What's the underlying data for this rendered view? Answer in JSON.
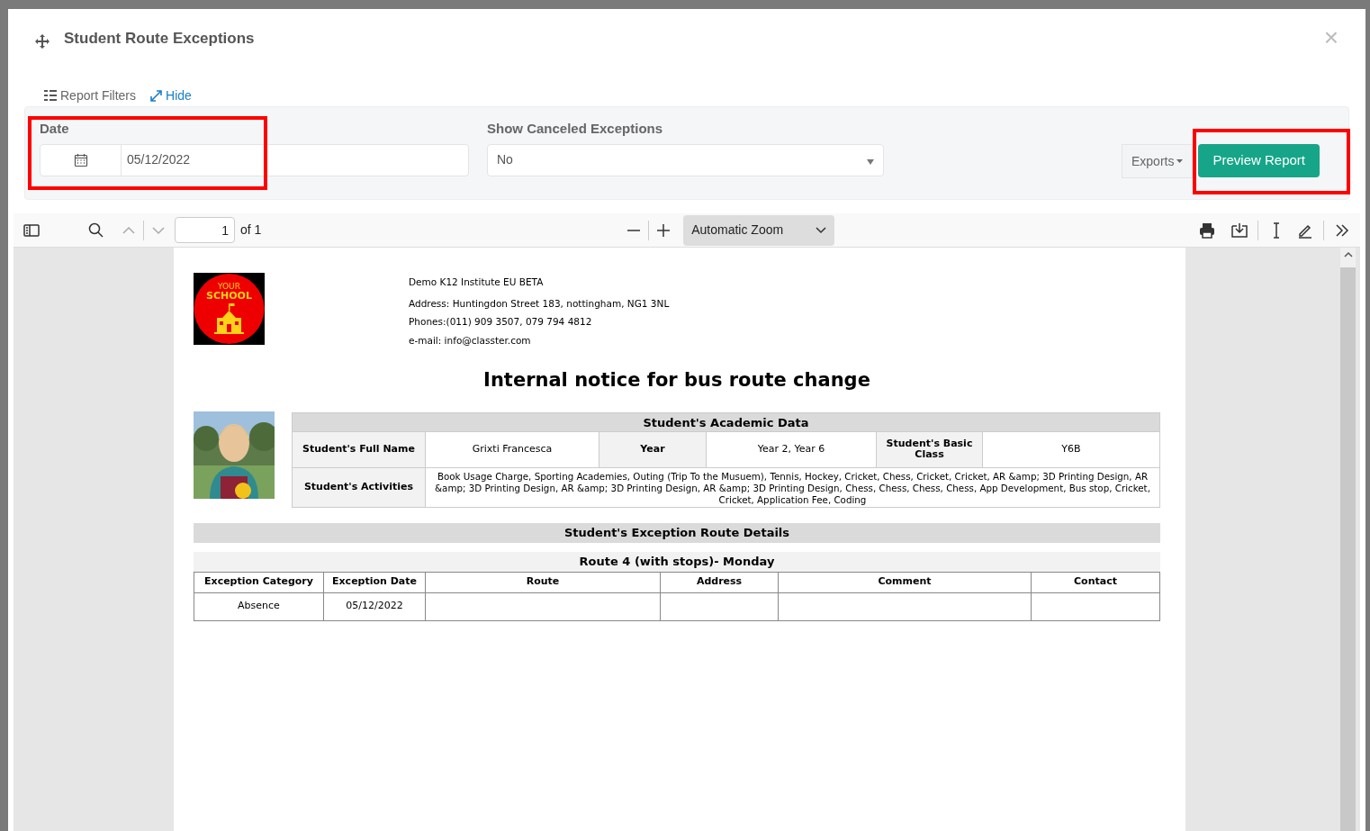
{
  "dialog": {
    "title": "Student Route Exceptions",
    "close": "×"
  },
  "filters": {
    "header": "Report Filters",
    "toggle": "Hide",
    "date": {
      "label": "Date",
      "value": "05/12/2022",
      "highlighted": true
    },
    "canceled": {
      "label": "Show Canceled Exceptions",
      "value": "No"
    },
    "exports": "Exports",
    "preview": {
      "label": "Preview Report",
      "highlighted": true
    }
  },
  "viewer": {
    "page": "1",
    "page_count": "of 1",
    "zoom": "Automatic Zoom"
  },
  "report": {
    "logo_text": [
      "YOUR",
      "SCHOOL"
    ],
    "school_lines": [
      "Demo K12 Institute EU BETA",
      "Address: Huntingdon Street 183, nottingham, NG1 3NL",
      "Phones:(011) 909 3507, 079 794 4812",
      "e-mail: info@classter.com"
    ],
    "title": "Internal notice for bus route change",
    "academic": {
      "title": "Student's Academic Data",
      "row1": [
        {
          "text": "Student's Full Name",
          "kind": "head"
        },
        {
          "text": "Grixti Francesca",
          "kind": "value"
        },
        {
          "text": "Year",
          "kind": "head"
        },
        {
          "text": "Year 2, Year 6",
          "kind": "value"
        },
        {
          "text": "Student's Basic Class",
          "kind": "head"
        },
        {
          "text": "Y6B",
          "kind": "value"
        }
      ],
      "activities_label": "Student's Activities",
      "activities": "Book Usage Charge, Sporting Academies, Outing (Trip To the Musuem), Tennis, Hockey, Cricket, Chess, Cricket, Cricket, AR &amp; 3D Printing Design, AR &amp; 3D Printing Design, AR &amp; 3D Printing Design, AR &amp; 3D Printing Design, Chess, Chess, Chess, Chess, App Development, Bus stop, Cricket, Cricket, Application Fee, Coding"
    },
    "details_title": "Student's Exception Route Details",
    "route_title": "Route 4 (with stops)- Monday",
    "columns": [
      "Exception Category",
      "Exception Date",
      "Route",
      "Address",
      "Comment",
      "Contact"
    ],
    "rows": [
      [
        "Absence",
        "05/12/2022",
        "",
        "",
        "",
        ""
      ]
    ]
  }
}
